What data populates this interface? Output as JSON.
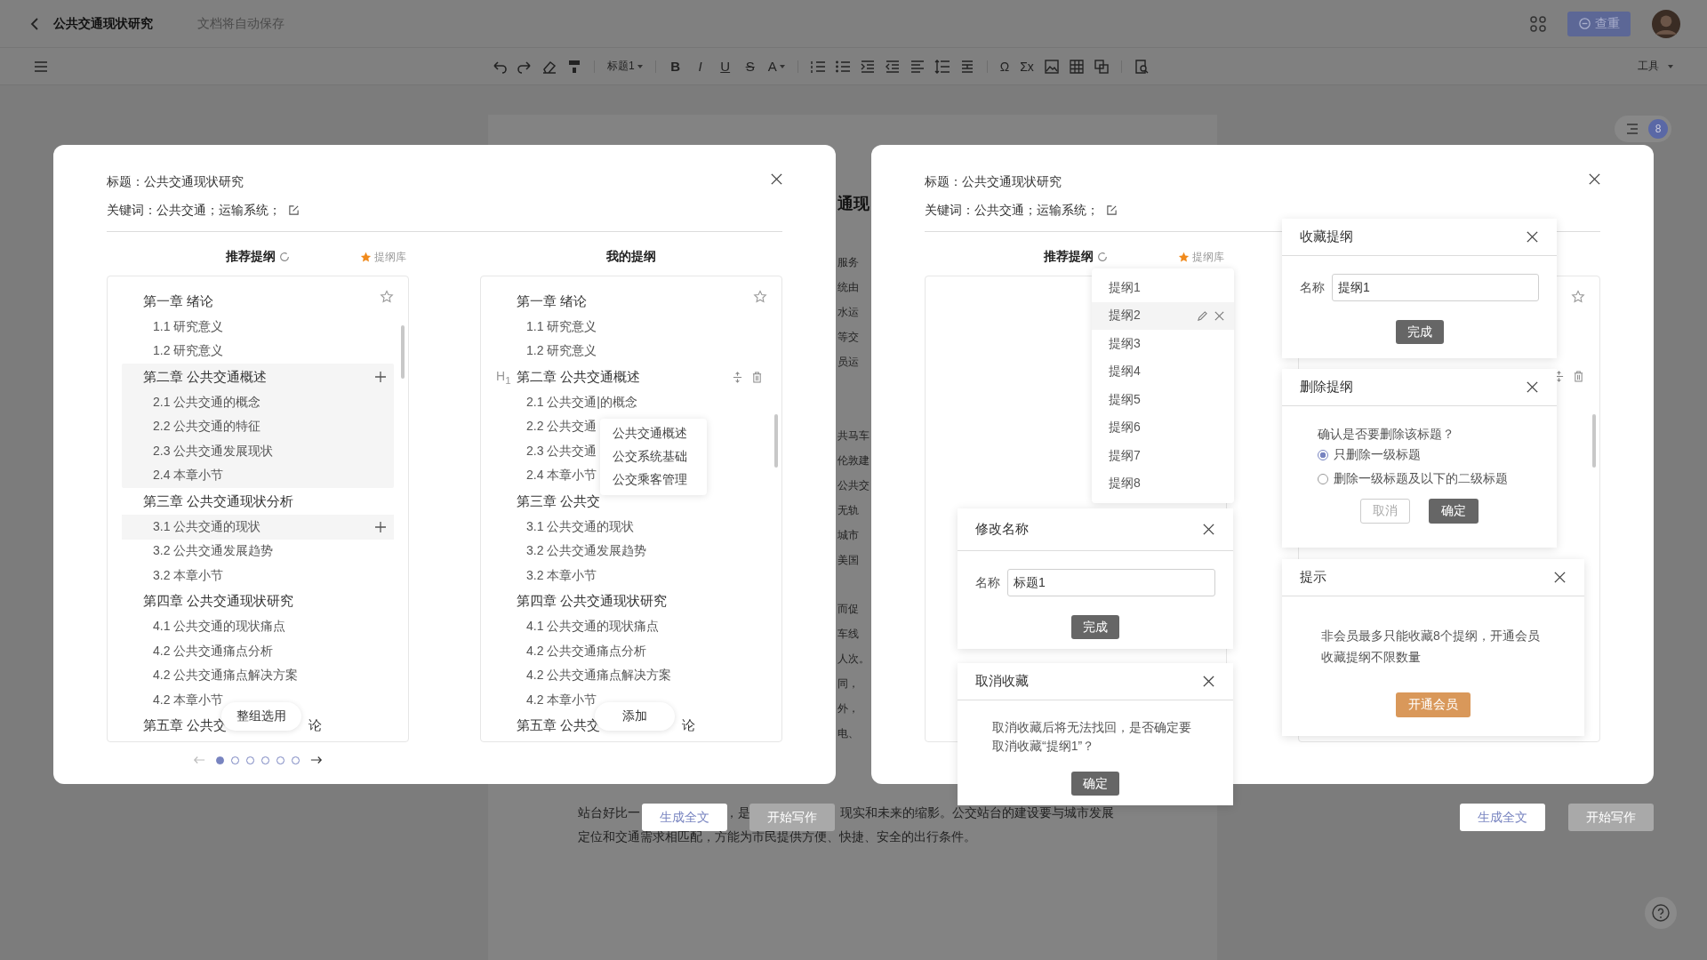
{
  "top_bar": {
    "title": "公共交通现状研究",
    "save_status": "文档将自动保存",
    "check_button": "查重"
  },
  "toolbar": {
    "heading_style": "标题1",
    "text_format": [
      "B",
      "I",
      "U",
      "S",
      "A"
    ],
    "symbol": "Ω",
    "formula": "Σx",
    "tools_menu": "工具"
  },
  "outline_toggle": {
    "badge": "8"
  },
  "document": {
    "heading": "通现",
    "fragments": [
      [
        "服务",
        "统由",
        "水运",
        "等交",
        "员运"
      ],
      [
        "共马车",
        "伦敦建",
        "公共交",
        "无轨",
        "城市",
        "美国"
      ],
      [
        "而促",
        "车线",
        "人次。",
        "同，",
        "外，",
        "电、"
      ]
    ],
    "bottom_lines": [
      [
        "站台好比一",
        "，是",
        "现实和未来的缩影。公交站台的建设要与城市发展"
      ],
      [
        "定位和交通需求相匹配，方能为市民提供方便、快捷、安全的出行条件。"
      ]
    ]
  },
  "dialog_left": {
    "title": "标题：公共交通现状研究",
    "keywords": "关键词：公共交通；运输系统；",
    "recommended_heading": "推荐提纲",
    "library_link": "提纲库",
    "my_heading": "我的提纲",
    "recommended": [
      {
        "title": "第一章 绪论",
        "hovered": false,
        "children": [
          {
            "title": "1.1 研究意义",
            "hovered": false
          },
          {
            "title": "1.2 研究意义",
            "hovered": false
          }
        ]
      },
      {
        "title": "第二章 公共交通概述",
        "hovered": true,
        "children": [
          {
            "title": "2.1 公共交通的概念",
            "hovered": false
          },
          {
            "title": "2.2 公共交通的特征",
            "hovered": false
          },
          {
            "title": "2.3 公共交通发展现状",
            "hovered": false
          },
          {
            "title": "2.4 本章小节",
            "hovered": false
          }
        ]
      },
      {
        "title": "第三章 公共交通现状分析",
        "hovered": false,
        "children": [
          {
            "title": "3.1 公共交通的现状",
            "hovered": true
          },
          {
            "title": "3.2 公共交通发展趋势",
            "hovered": false
          },
          {
            "title": "3.2 本章小节",
            "hovered": false
          }
        ]
      },
      {
        "title": "第四章 公共交通现状研究",
        "hovered": false,
        "children": [
          {
            "title": "4.1 公共交通的现状痛点",
            "hovered": false
          },
          {
            "title": "4.2 公共交通痛点分析",
            "hovered": false
          },
          {
            "title": "4.2 公共交通痛点解决方案",
            "hovered": false
          },
          {
            "title": "4.2 本章小节",
            "hovered": false
          }
        ]
      },
      {
        "title": "第五章 公共交",
        "title_end": "论",
        "hovered": false
      }
    ],
    "apply_button": "整组选用",
    "mine": [
      {
        "title": "第一章 绪论",
        "active": false,
        "children": [
          {
            "title": "1.1 研究意义"
          },
          {
            "title": "1.2 研究意义"
          }
        ]
      },
      {
        "title": "第二章 公共交通概述",
        "active": true,
        "tag": "H$_{1}$",
        "children": [
          {
            "title": "2.1 公共交通|的概念"
          },
          {
            "title": "2.2 公共交通"
          },
          {
            "title": "2.3 公共交通"
          },
          {
            "title": "2.4 本章小节"
          }
        ]
      },
      {
        "title": "第三章 公共交",
        "active": false,
        "children": [
          {
            "title": "3.1 公共交通的现状"
          },
          {
            "title": "3.2 公共交通发展趋势"
          },
          {
            "title": "3.2 本章小节"
          }
        ]
      },
      {
        "title": "第四章 公共交通现状研究",
        "active": false,
        "children": [
          {
            "title": "4.1 公共交通的现状痛点"
          },
          {
            "title": "4.2 公共交通痛点分析"
          },
          {
            "title": "4.2 公共交通痛点解决方案"
          },
          {
            "title": "4.2 本章小节"
          }
        ]
      },
      {
        "title": "第五章 公共交",
        "title_end": "论",
        "active": false
      }
    ],
    "add_button": "添加",
    "suggestions": [
      "公共交通概述",
      "公交系统基础",
      "公交乘客管理"
    ],
    "pages": [
      {
        "selected": true
      },
      {
        "selected": false
      },
      {
        "selected": false
      },
      {
        "selected": false
      },
      {
        "selected": false
      },
      {
        "selected": false
      }
    ],
    "footer_buttons": [
      "生成全文",
      "开始写作"
    ]
  },
  "dialog_right": {
    "title": "标题：公共交通现状研究",
    "keywords": "关键词：公共交通；运输系统；",
    "recommended_heading": "推荐提纲",
    "library_link": "提纲库",
    "saved_outlines": [
      {
        "name": "提纲1",
        "hovered": false
      },
      {
        "name": "提纲2",
        "hovered": true
      },
      {
        "name": "提纲3",
        "hovered": false
      },
      {
        "name": "提纲4",
        "hovered": false
      },
      {
        "name": "提纲5",
        "hovered": false
      },
      {
        "name": "提纲6",
        "hovered": false
      },
      {
        "name": "提纲7",
        "hovered": false
      },
      {
        "name": "提纲8",
        "hovered": false
      }
    ],
    "rename_card": {
      "title": "修改名称",
      "label": "名称",
      "value": "标题1",
      "button": "完成"
    },
    "unfavorite_card": {
      "title": "取消收藏",
      "message": "取消收藏后将无法找回，是否确定要取消收藏“提纲1”？",
      "button": "确定"
    },
    "favorite_card": {
      "title": "收藏提纲",
      "label": "名称",
      "value": "提纲1",
      "button": "完成"
    },
    "delete_card": {
      "title": "删除提纲",
      "question": "确认是否要删除该标题？",
      "options": [
        {
          "label": "只删除一级标题",
          "selected": true
        },
        {
          "label": "删除一级标题及以下的二级标题",
          "selected": false
        }
      ],
      "cancel": "取消",
      "confirm": "确定"
    },
    "tip_card": {
      "title": "提示",
      "message": "非会员最多只能收藏8个提纲，开通会员收藏提纲不限数量",
      "button": "开通会员"
    },
    "footer_buttons": [
      "生成全文",
      "开始写作"
    ]
  }
}
